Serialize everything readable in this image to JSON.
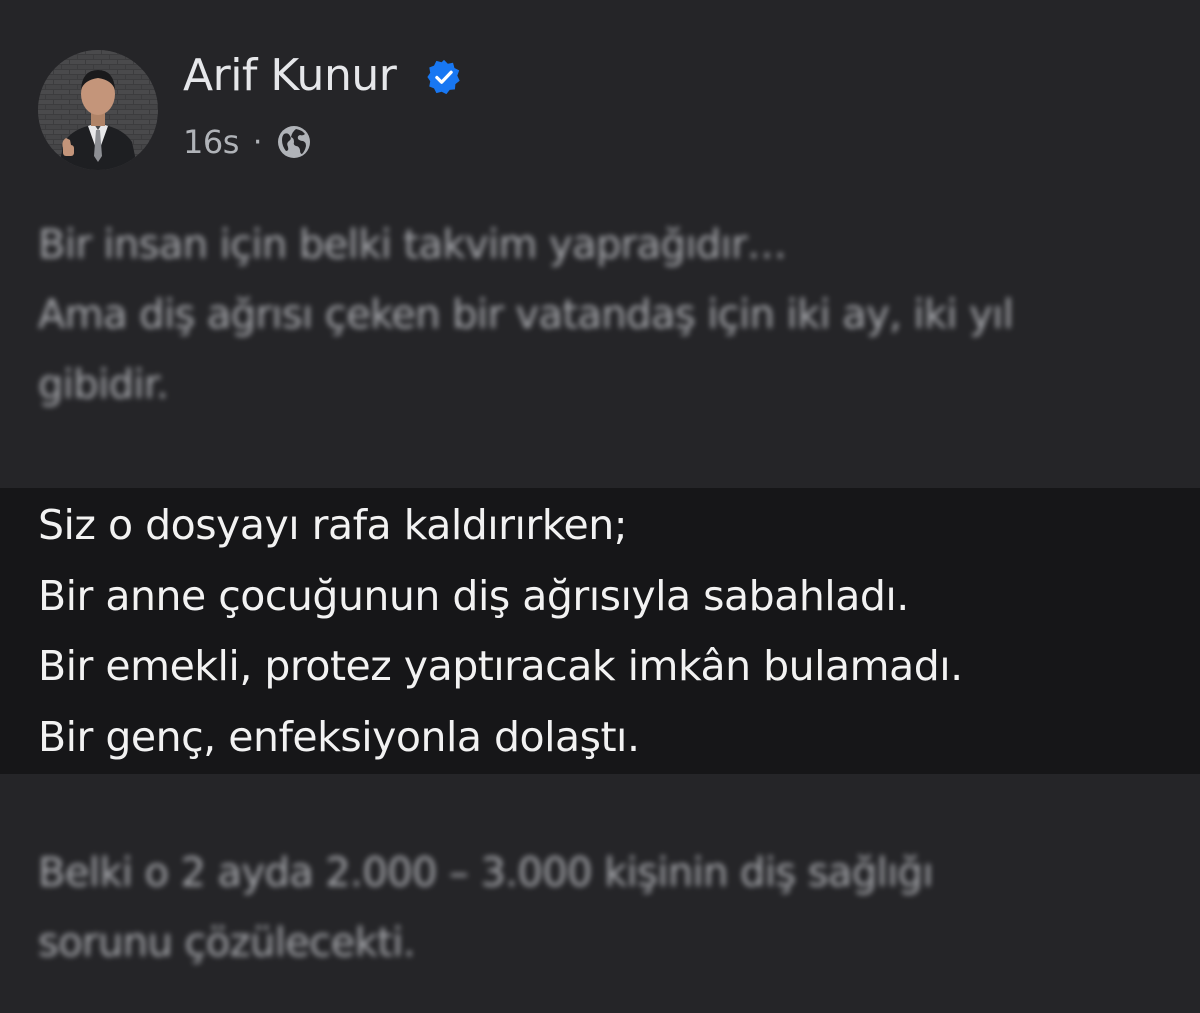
{
  "author": {
    "name": "Arif Kunur",
    "verified_icon": "verified-badge-icon",
    "avatar_icon": "profile-photo"
  },
  "meta": {
    "time": "16s",
    "separator": "·",
    "audience_icon": "globe-icon"
  },
  "paragraphs": {
    "first": [
      "Bir insan için belki takvim yaprağıdır…",
      "Ama diş ağrısı çeken bir vatandaş için iki ay, iki yıl",
      "gibidir."
    ],
    "highlighted": [
      "Siz o dosyayı rafa kaldırırken;",
      "Bir anne çocuğunun diş ağrısıyla sabahladı.",
      "Bir emekli, protez yaptıracak imkân bulamadı.",
      "Bir genç, enfeksiyonla dolaştı."
    ],
    "last": [
      "Belki o 2 ayda 2.000 – 3.000 kişinin diş sağlığı",
      "sorunu çözülecekti."
    ]
  },
  "colors": {
    "background": "#252528",
    "highlight_band": "#161618",
    "verified_blue": "#1877f2",
    "text_primary": "#e4e6eb",
    "text_secondary": "#b0b3b8"
  }
}
